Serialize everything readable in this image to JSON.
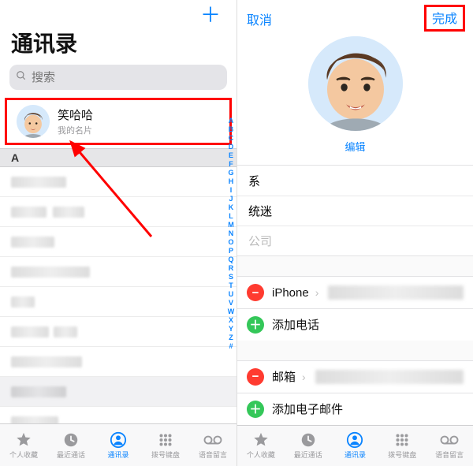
{
  "left": {
    "title": "通讯录",
    "search_placeholder": "搜索",
    "mycard": {
      "name": "笑哈哈",
      "subtitle": "我的名片"
    },
    "section_letter": "A",
    "index_letters": [
      "A",
      "B",
      "C",
      "D",
      "E",
      "F",
      "G",
      "H",
      "I",
      "J",
      "K",
      "L",
      "M",
      "N",
      "O",
      "P",
      "Q",
      "R",
      "S",
      "T",
      "U",
      "V",
      "W",
      "X",
      "Y",
      "Z",
      "#"
    ]
  },
  "right": {
    "cancel": "取消",
    "done": "完成",
    "edit": "编辑",
    "first_name": "系",
    "last_name": "统迷",
    "company_placeholder": "公司",
    "phone_type": "iPhone",
    "add_phone": "添加电话",
    "email_label": "邮箱",
    "add_email": "添加电子邮件"
  },
  "tabs": {
    "favorites": "个人收藏",
    "recents": "最近通话",
    "contacts": "通讯录",
    "keypad": "拨号键盘",
    "voicemail": "语音留言"
  }
}
